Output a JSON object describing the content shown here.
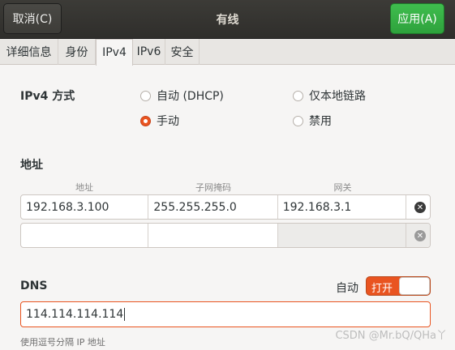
{
  "header": {
    "cancel_label": "取消(C)",
    "title": "有线",
    "apply_label": "应用(A)"
  },
  "tabs": [
    {
      "label": "详细信息"
    },
    {
      "label": "身份"
    },
    {
      "label": "IPv4",
      "active": true
    },
    {
      "label": "IPv6"
    },
    {
      "label": "安全"
    }
  ],
  "ipv4": {
    "method_label": "IPv4 方式",
    "methods": [
      {
        "label": "自动 (DHCP)",
        "checked": false
      },
      {
        "label": "仅本地链路",
        "checked": false
      },
      {
        "label": "手动",
        "checked": true
      },
      {
        "label": "禁用",
        "checked": false
      }
    ]
  },
  "addresses": {
    "section_label": "地址",
    "col_address": "地址",
    "col_netmask": "子网掩码",
    "col_gateway": "网关",
    "rows": [
      {
        "address": "192.168.3.100",
        "netmask": "255.255.255.0",
        "gateway": "192.168.3.1"
      },
      {
        "address": "",
        "netmask": "",
        "gateway": ""
      }
    ]
  },
  "dns": {
    "section_label": "DNS",
    "auto_label": "自动",
    "toggle_label": "打开",
    "toggle_on": true,
    "value": "114.114.114.114",
    "hint": "使用逗号分隔 IP 地址"
  },
  "watermark": "CSDN @Mr.bQ/QHa丫"
}
